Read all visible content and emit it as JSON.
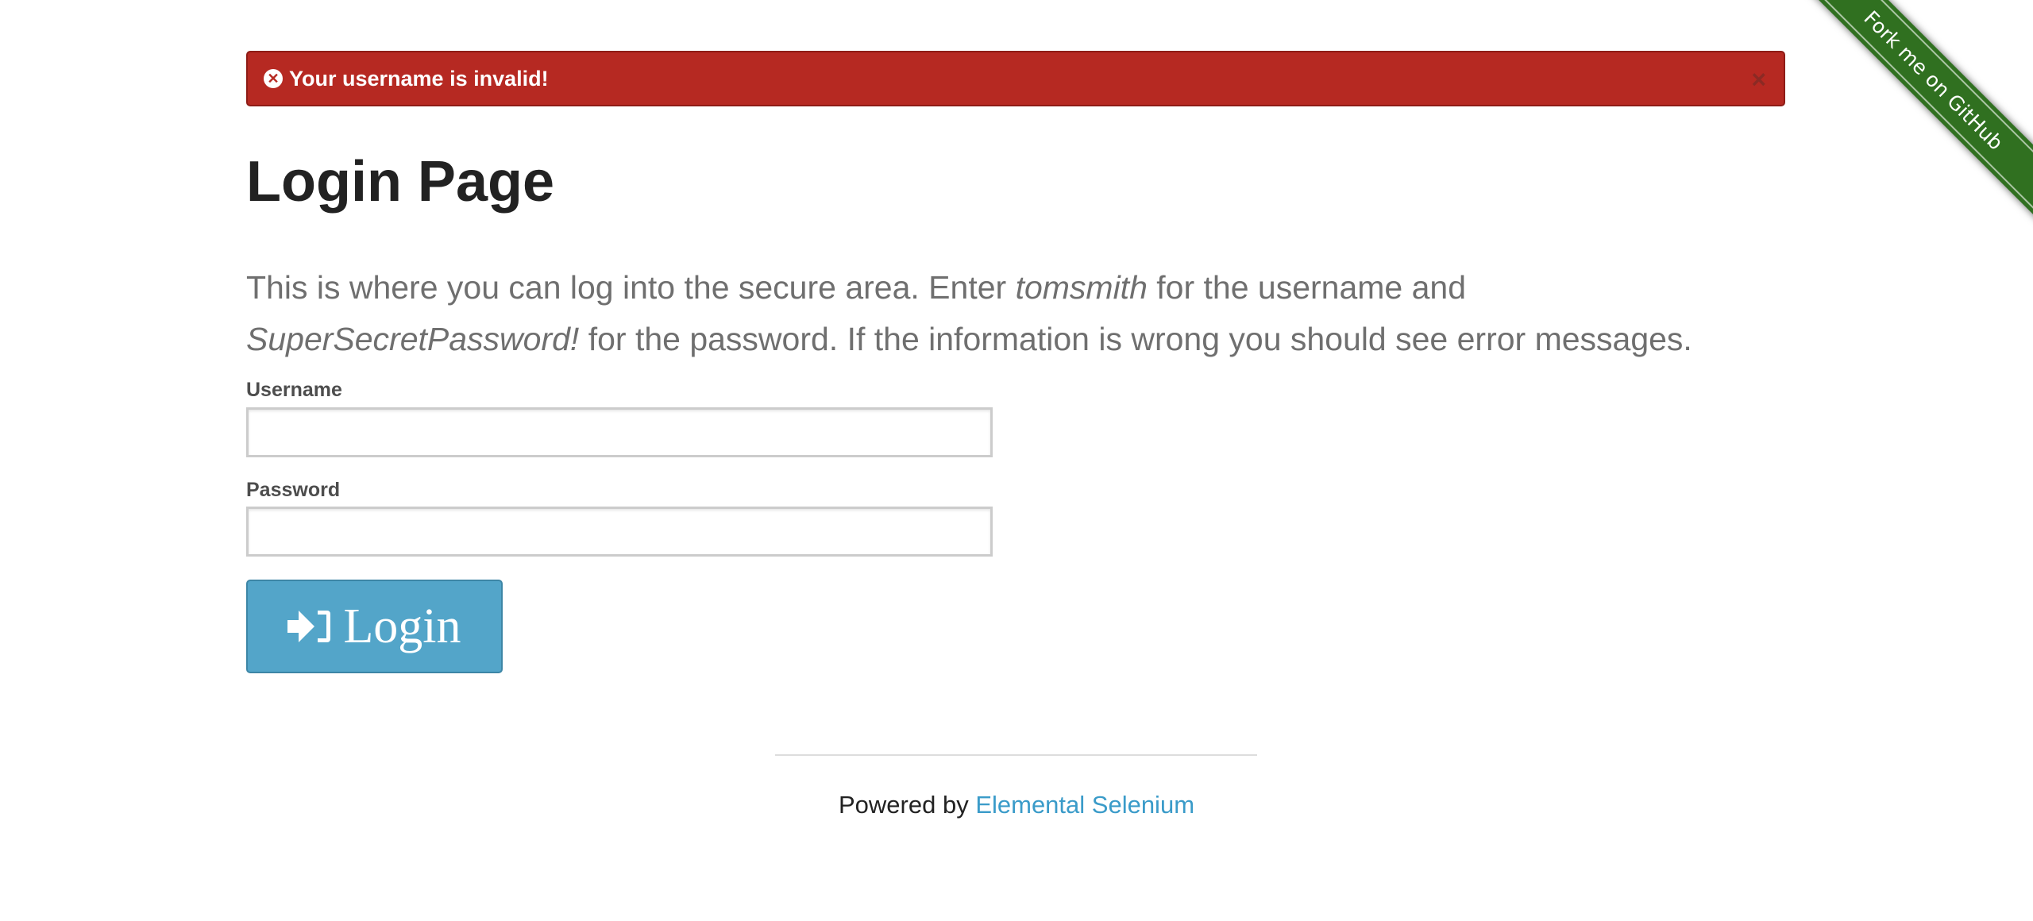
{
  "flash": {
    "message": "Your username is invalid!",
    "close": "×",
    "icon": "times-circle-icon",
    "color": "#b62922"
  },
  "ribbon": {
    "label": "Fork me on GitHub",
    "color": "#307020"
  },
  "page": {
    "title": "Login Page",
    "intro_1": "This is where you can log into the secure area. Enter ",
    "intro_user": "tomsmith",
    "intro_2": " for the username and ",
    "intro_pass": "SuperSecretPassword!",
    "intro_3": " for the password. If the information is wrong you should see error messages."
  },
  "form": {
    "username_label": "Username",
    "username_value": "",
    "password_label": "Password",
    "password_value": "",
    "login_label": "Login",
    "login_icon": "sign-in-icon",
    "button_color": "#53a5c9"
  },
  "footer": {
    "prefix": "Powered by ",
    "link": "Elemental Selenium"
  }
}
